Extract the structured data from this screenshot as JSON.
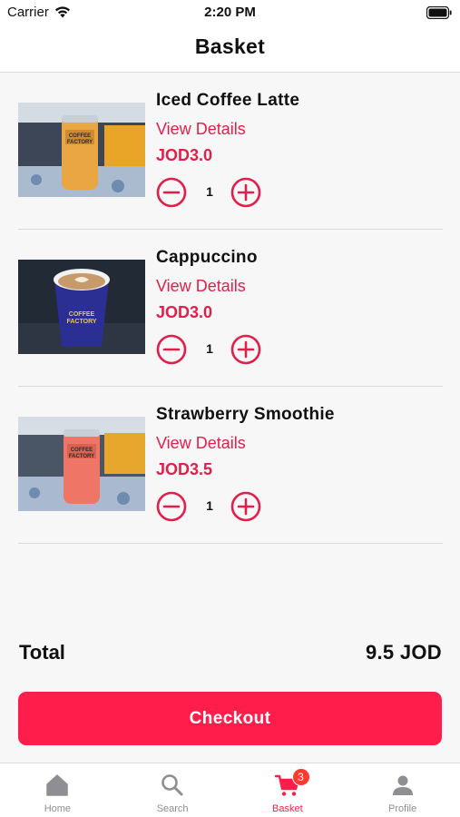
{
  "status_bar": {
    "carrier": "Carrier",
    "time": "2:20 PM"
  },
  "header": {
    "title": "Basket"
  },
  "items": [
    {
      "name": "Iced Coffee Latte",
      "details_label": "View Details",
      "price": "JOD3.0",
      "quantity": "1"
    },
    {
      "name": "Cappuccino",
      "details_label": "View Details",
      "price": "JOD3.0",
      "quantity": "1"
    },
    {
      "name": "Strawberry Smoothie",
      "details_label": "View Details",
      "price": "JOD3.5",
      "quantity": "1"
    }
  ],
  "summary": {
    "total_label": "Total",
    "total_value": "9.5 JOD"
  },
  "checkout": {
    "label": "Checkout"
  },
  "tabs": [
    {
      "label": "Home",
      "icon": "home-icon"
    },
    {
      "label": "Search",
      "icon": "search-icon"
    },
    {
      "label": "Basket",
      "icon": "cart-icon",
      "badge": "3"
    },
    {
      "label": "Profile",
      "icon": "person-icon"
    }
  ],
  "colors": {
    "accent": "#fe1d4b",
    "accent_text": "#e0204a",
    "badge": "#ff3b30",
    "tab_inactive": "#8e8e93"
  }
}
